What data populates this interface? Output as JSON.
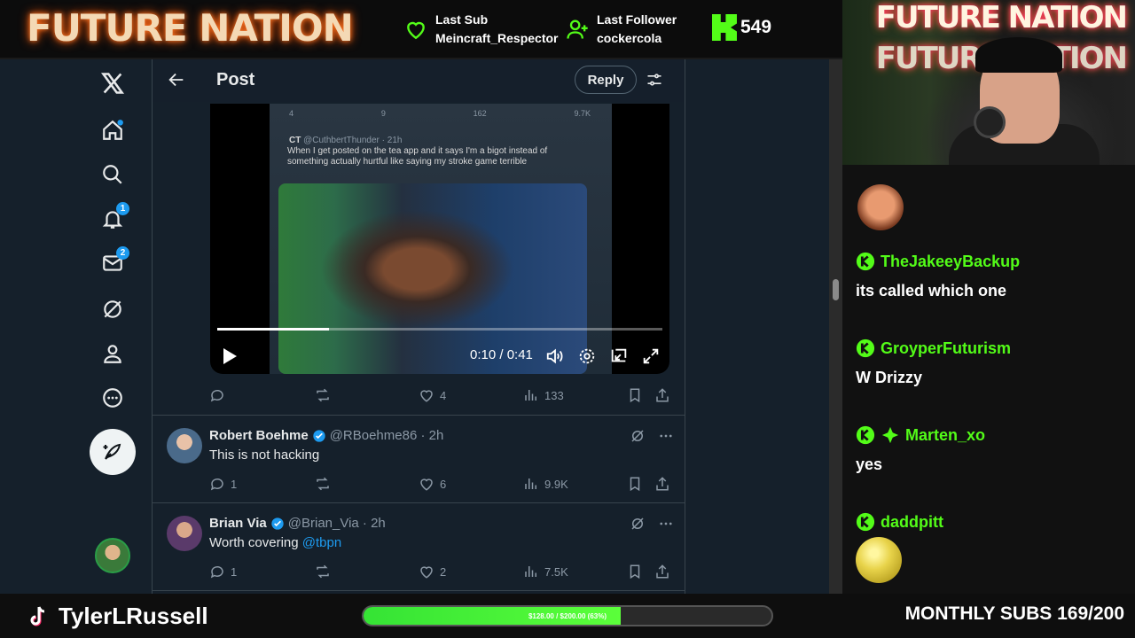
{
  "overlay": {
    "brand": "FUTURE NATION",
    "last_sub_label": "Last Sub",
    "last_sub_name": "Meincraft_Respector",
    "last_follower_label": "Last Follower",
    "last_follower_name": "cockercola",
    "kick_followers": "549",
    "channel_name": "TylerLRussell",
    "goal_text": "$128.00 / $200.00 (63%)",
    "goal_fraction": 0.63,
    "monthly_subs": "MONTHLY SUBS 169/200",
    "accent_color": "#53fc18"
  },
  "x": {
    "header_title": "Post",
    "reply_button": "Reply",
    "nav_badges": {
      "notifications": "1",
      "messages": "2"
    },
    "embed": {
      "author": "CT",
      "handle": "@CuthbertThunder · 21h",
      "text": "When I get posted on the tea app and it says I'm a bigot instead of something actually hurtful like saying my stroke game terrible",
      "stats": [
        "4",
        "9",
        "162",
        "9.7K"
      ]
    },
    "video": {
      "time": "0:10 / 0:41",
      "progress_fraction": 0.25
    },
    "post_actions": {
      "replies": "",
      "reposts": "",
      "likes": "4",
      "views": "133"
    },
    "replies": [
      {
        "name": "Robert Boehme",
        "handle": "@RBoehme86 · 2h",
        "text": "This is not hacking",
        "mention": "",
        "replies": "1",
        "likes": "6",
        "views": "9.9K"
      },
      {
        "name": "Brian Via",
        "handle": "@Brian_Via · 2h",
        "text": "Worth covering ",
        "mention": "@tbpn",
        "replies": "1",
        "likes": "2",
        "views": "7.5K"
      }
    ]
  },
  "chat": {
    "messages": [
      {
        "user": "TheJakeeyBackup",
        "text": "its called which one"
      },
      {
        "user": "GroyperFuturism",
        "text": "W Drizzy"
      },
      {
        "user": "Marten_xo",
        "text": "yes"
      },
      {
        "user": "daddpitt",
        "text": ""
      }
    ]
  },
  "cam_sign": "FUTURE NATION"
}
